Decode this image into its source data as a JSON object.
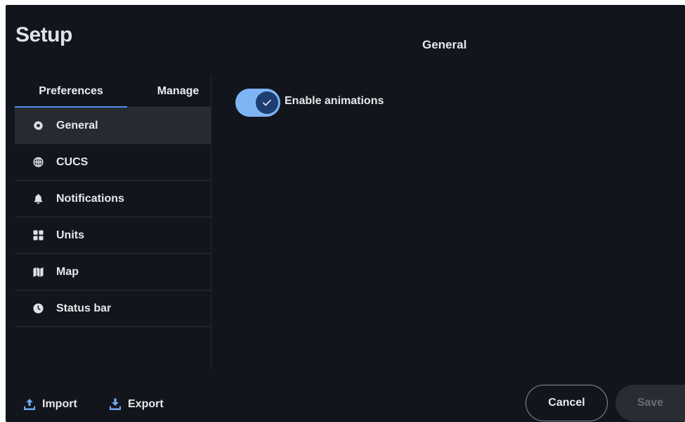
{
  "dialog": {
    "title": "Setup"
  },
  "tabs": [
    {
      "label": "Preferences",
      "active": true
    },
    {
      "label": "Manage",
      "active": false
    }
  ],
  "nav": [
    {
      "label": "General",
      "icon": "gear-icon",
      "active": true
    },
    {
      "label": "CUCS",
      "icon": "globe-icon",
      "active": false
    },
    {
      "label": "Notifications",
      "icon": "bell-icon",
      "active": false
    },
    {
      "label": "Units",
      "icon": "grid-icon",
      "active": false
    },
    {
      "label": "Map",
      "icon": "map-icon",
      "active": false
    },
    {
      "label": "Status bar",
      "icon": "clock-icon",
      "active": false
    }
  ],
  "main": {
    "title": "General",
    "settings": [
      {
        "label": "Enable animations",
        "enabled": true
      }
    ]
  },
  "footer": {
    "import_label": "Import",
    "export_label": "Export",
    "cancel_label": "Cancel",
    "save_label": "Save",
    "save_enabled": false
  },
  "colors": {
    "background": "#12151b",
    "accent": "#4d8ff0",
    "toggle_track": "#7fb4f5",
    "toggle_knob": "#1d3e70",
    "active_item": "#262a31"
  }
}
